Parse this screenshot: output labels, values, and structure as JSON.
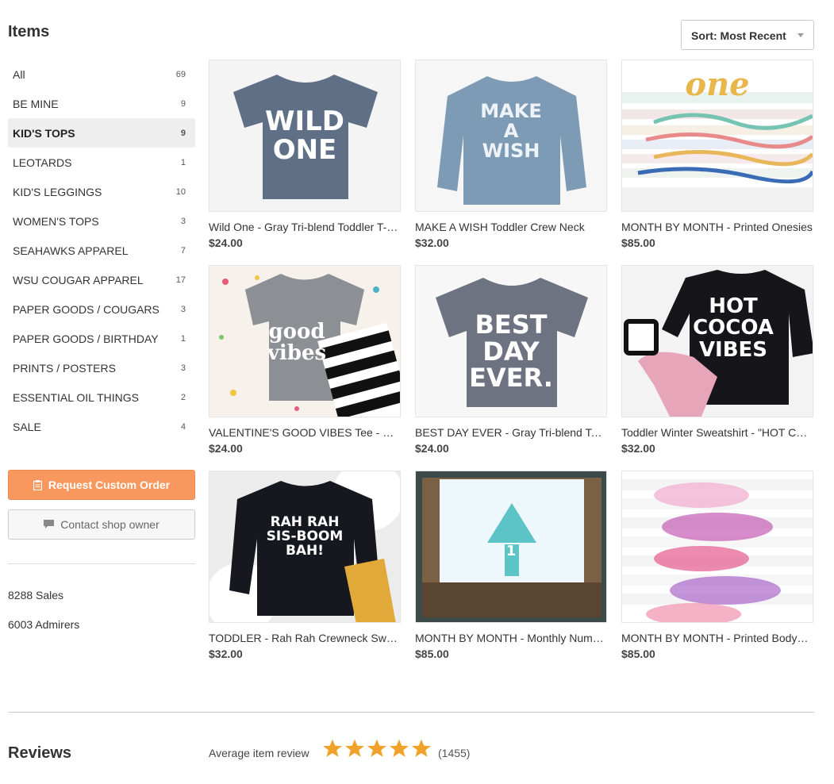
{
  "header": {
    "title": "Items",
    "sort_label": "Sort: Most Recent"
  },
  "sidebar": {
    "categories": [
      {
        "label": "All",
        "count": "69"
      },
      {
        "label": "BE MINE",
        "count": "9"
      },
      {
        "label": "KID'S TOPS",
        "count": "9"
      },
      {
        "label": "LEOTARDS",
        "count": "1"
      },
      {
        "label": "KID'S LEGGINGS",
        "count": "10"
      },
      {
        "label": "WOMEN'S TOPS",
        "count": "3"
      },
      {
        "label": "SEAHAWKS APPAREL",
        "count": "7"
      },
      {
        "label": "WSU COUGAR APPAREL",
        "count": "17"
      },
      {
        "label": "PAPER GOODS / COUGARS",
        "count": "3"
      },
      {
        "label": "PAPER GOODS / BIRTHDAY",
        "count": "1"
      },
      {
        "label": "PRINTS / POSTERS",
        "count": "3"
      },
      {
        "label": "ESSENTIAL OIL THINGS",
        "count": "2"
      },
      {
        "label": "SALE",
        "count": "4"
      }
    ],
    "request_button": "Request Custom Order",
    "contact_button": "Contact shop owner",
    "sales": "8288 Sales",
    "admirers": "6003 Admirers"
  },
  "items": [
    {
      "title": "Wild One - Gray Tri-blend Toddler T-Shirt",
      "price": "$24.00",
      "art": "WILD\nONE"
    },
    {
      "title": "MAKE A WISH Toddler Crew Neck",
      "price": "$32.00",
      "art": "MAKE\nA\nWISH"
    },
    {
      "title": "MONTH BY MONTH - Printed Onesies",
      "price": "$85.00",
      "art": "one"
    },
    {
      "title": "VALENTINE'S GOOD VIBES Tee - Gray",
      "price": "$24.00",
      "art": "good\nvibes"
    },
    {
      "title": "BEST DAY EVER - Gray Tri-blend Toddler Tee",
      "price": "$24.00",
      "art": "BEST\nDAY\nEVER."
    },
    {
      "title": "Toddler Winter Sweatshirt - \"HOT COCOA VIBES\"",
      "price": "$32.00",
      "art": "HOT\nCOCOA\nVIBES"
    },
    {
      "title": "TODDLER - Rah Rah Crewneck Sweatshirt",
      "price": "$32.00",
      "art": "RAH RAH\nSIS-BOOM\nBAH!"
    },
    {
      "title": "MONTH BY MONTH - Monthly Numbered Onesies",
      "price": "$85.00",
      "art": "1"
    },
    {
      "title": "MONTH BY MONTH - Printed Bodysuits",
      "price": "$85.00",
      "art": ""
    }
  ],
  "reviews": {
    "title": "Reviews",
    "avg_label": "Average item review",
    "rating": 5,
    "count": "(1455)"
  },
  "colors": {
    "accent": "#f8985f",
    "star": "#f1a22a"
  }
}
